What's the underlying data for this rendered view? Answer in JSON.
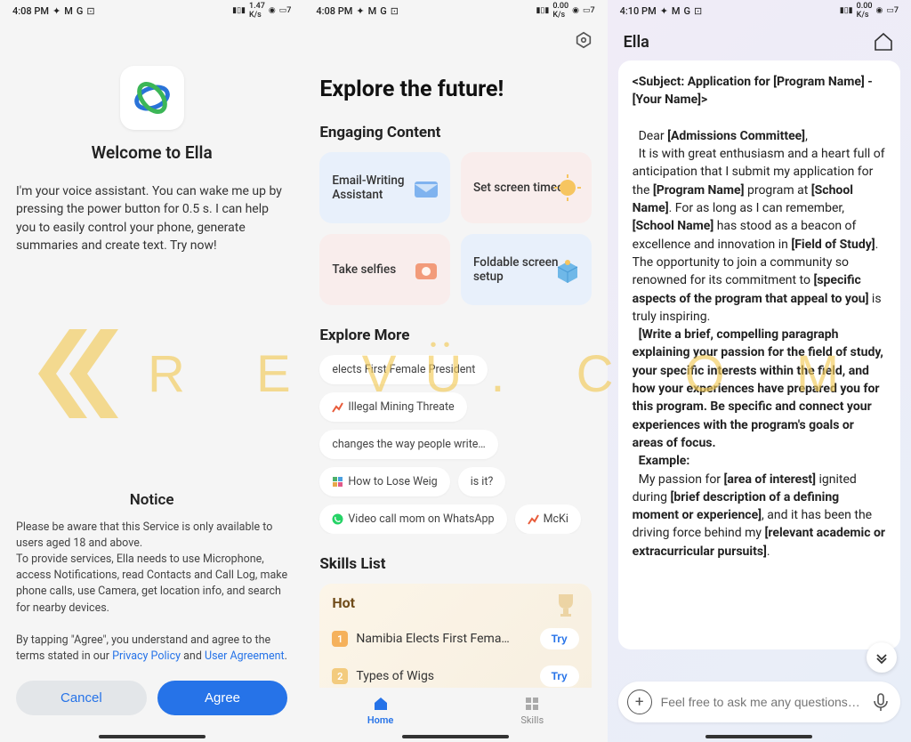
{
  "phone1": {
    "status": {
      "time": "4:08 PM",
      "net": "1.47",
      "net_unit": "K/s"
    },
    "title": "Welcome to Ella",
    "description": "I'm your voice assistant. You can wake me up by pressing the power button for 0.5 s. I can help you to easily control your phone, generate summaries and create text. Try now!",
    "notice_title": "Notice",
    "notice_p1": "Please be aware that this Service is only available to users aged 18 and above.",
    "notice_p2": "To provide services, Ella needs to use Microphone, access Notifications, read Contacts and Call Log, make phone calls, use Camera, get location info, and search for nearby devices.",
    "notice_p3_prefix": "By tapping \"Agree\", you understand and agree to the terms stated in our ",
    "privacy_link": "Privacy Policy",
    "notice_and": " and ",
    "user_agreement_link": "User Agreement",
    "notice_period": ".",
    "cancel_label": "Cancel",
    "agree_label": "Agree"
  },
  "phone2": {
    "status": {
      "time": "4:08 PM",
      "net": "0.00",
      "net_unit": "K/s"
    },
    "title": "Explore the future!",
    "engaging_label": "Engaging Content",
    "cards": [
      {
        "label": "Email-Writing Assistant",
        "icon": "mail-icon"
      },
      {
        "label": "Set screen timeout",
        "icon": "sun-icon"
      },
      {
        "label": "Take selfies",
        "icon": "camera-icon"
      },
      {
        "label": "Foldable screen setup",
        "icon": "box-icon"
      }
    ],
    "explore_label": "Explore More",
    "chips": [
      {
        "label": "elects First Female President",
        "icon": null
      },
      {
        "label": "Illegal Mining Threate",
        "icon": "chart-icon"
      },
      {
        "label": "changes the way people write…",
        "icon": null
      },
      {
        "label": "How to Lose Weig",
        "icon": "grid-icon"
      },
      {
        "label": "is it?",
        "icon": null
      },
      {
        "label": "Video call mom on WhatsApp",
        "icon": "whatsapp-icon"
      },
      {
        "label": "McKi",
        "icon": "chart-icon"
      }
    ],
    "skills_label": "Skills List",
    "hot_label": "Hot",
    "hot_items": [
      {
        "num": "1",
        "label": "Namibia Elects First Fema…",
        "try": "Try"
      },
      {
        "num": "2",
        "label": "Types of Wigs",
        "try": "Try"
      }
    ],
    "nav": {
      "home": "Home",
      "skills": "Skills"
    }
  },
  "phone3": {
    "status": {
      "time": "4:10 PM",
      "net": "0.00",
      "net_unit": "K/s"
    },
    "header_title": "Ella",
    "subject": "<Subject: Application for [Program Name] - [Your Name]>",
    "dear_prefix": "Dear ",
    "dear_bold": "[Admissions Committee]",
    "dear_suffix": ",",
    "para1_1": "It is with great enthusiasm and a heart full of anticipation that I submit my application for the ",
    "para1_b1": "[Program Name]",
    "para1_2": " program at ",
    "para1_b2": "[School Name]",
    "para1_3": ".  For as long as I can remember, ",
    "para1_b3": "[School Name]",
    "para1_4": " has stood as a beacon of excellence and innovation in ",
    "para1_b4": "[Field of Study]",
    "para1_5": ". The opportunity to join a community so renowned for its commitment to ",
    "para1_b5": "[specific aspects of the program that appeal to you]",
    "para1_6": " is truly inspiring.",
    "para2": "[Write a brief, compelling paragraph explaining your passion for the field of study, your specific interests within the field, and how your experiences have prepared you for this program.  Be specific and connect your experiences with the program's goals or areas of focus.",
    "example_label": "Example:",
    "para3_1": "My passion for ",
    "para3_b1": "[area of interest]",
    "para3_2": " ignited during ",
    "para3_b2": "[brief description of a defining moment or experience]",
    "para3_3": ", and it has been the driving force behind my ",
    "para3_b3": "[relevant academic or extracurricular pursuits]",
    "para3_4": ".",
    "input_placeholder": "Feel free to ask me any questions…"
  },
  "watermark": "REVÜ.COM.PH"
}
